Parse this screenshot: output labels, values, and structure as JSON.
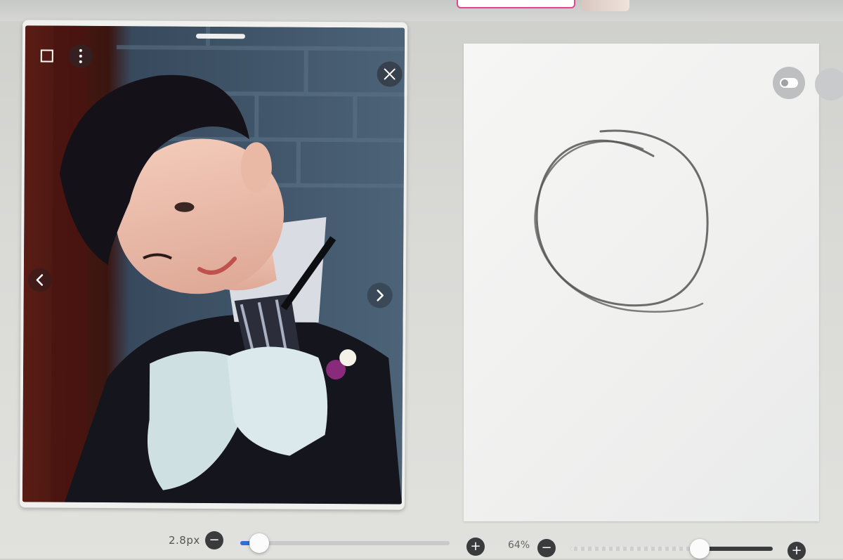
{
  "brush_size": {
    "label": "2.8px",
    "minus": "−",
    "plus": "+",
    "fraction": 0.09
  },
  "zoom": {
    "label": "64%",
    "minus": "−",
    "plus": "+",
    "fraction": 0.64
  },
  "reference_panel": {
    "icons": [
      "square-icon",
      "more-vertical-icon",
      "close-icon",
      "chevron-left-icon",
      "chevron-right-icon"
    ]
  },
  "canvas": {
    "content": "sketched circle",
    "stroke_color": "#555555"
  },
  "colors": {
    "slider_accent": "#2f6fd6",
    "button_dark": "#3a3b3d",
    "top_banner_border": "#e2468f"
  }
}
